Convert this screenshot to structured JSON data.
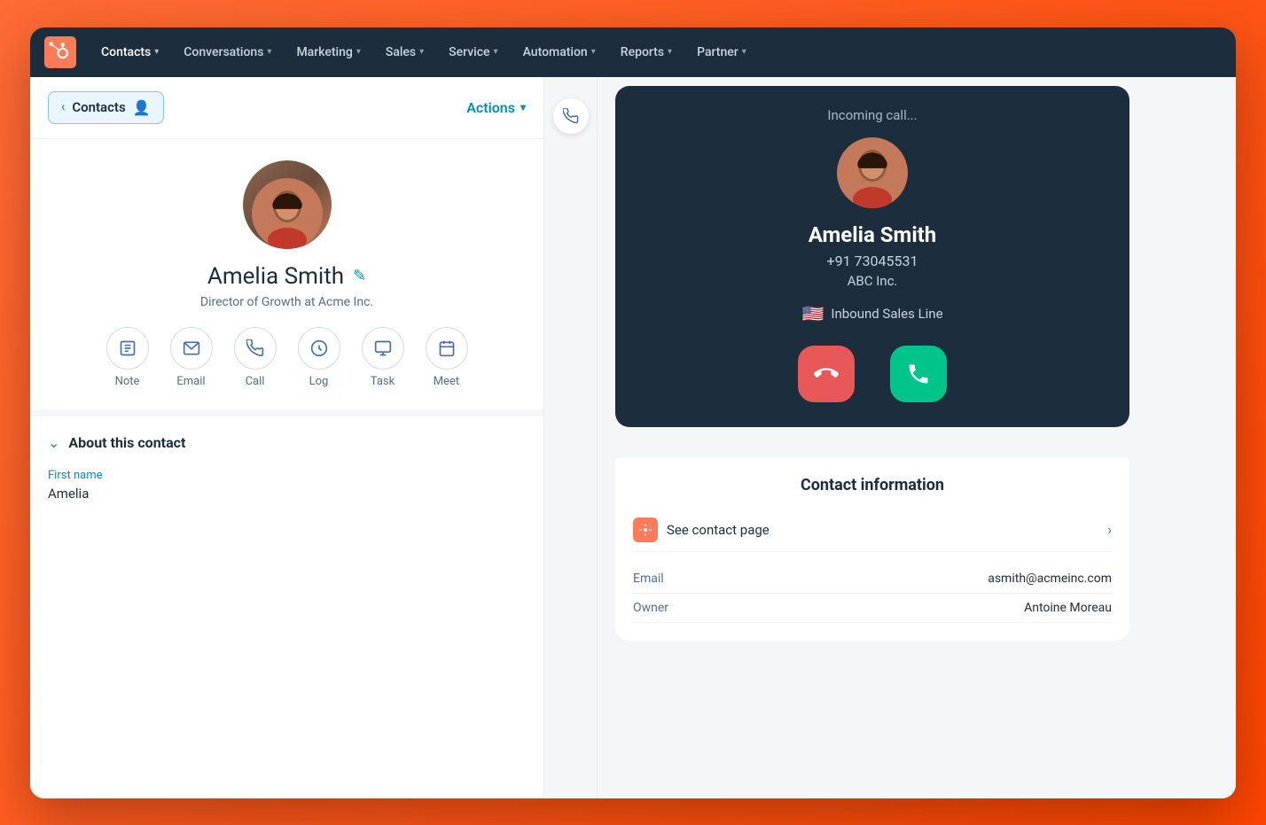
{
  "navbar": {
    "items": [
      {
        "label": "Contacts",
        "id": "contacts"
      },
      {
        "label": "Conversations",
        "id": "conversations"
      },
      {
        "label": "Marketing",
        "id": "marketing"
      },
      {
        "label": "Sales",
        "id": "sales"
      },
      {
        "label": "Service",
        "id": "service"
      },
      {
        "label": "Automation",
        "id": "automation"
      },
      {
        "label": "Reports",
        "id": "reports"
      },
      {
        "label": "Partner",
        "id": "partner"
      }
    ]
  },
  "panel": {
    "back_label": "Contacts",
    "actions_label": "Actions"
  },
  "contact": {
    "name": "Amelia Smith",
    "title": "Director of Growth at Acme Inc.",
    "actions": [
      {
        "icon": "✎",
        "label": "Note",
        "id": "note"
      },
      {
        "icon": "✉",
        "label": "Email",
        "id": "email"
      },
      {
        "icon": "✆",
        "label": "Call",
        "id": "call"
      },
      {
        "icon": "+",
        "label": "Log",
        "id": "log"
      },
      {
        "icon": "☰",
        "label": "Task",
        "id": "task"
      },
      {
        "icon": "▦",
        "label": "Meet",
        "id": "meet"
      }
    ],
    "about_title": "About this contact",
    "first_name_label": "First name",
    "first_name": "Amelia"
  },
  "incoming_call": {
    "label": "Incoming call...",
    "caller_name": "Amelia Smith",
    "caller_phone": "+91 73045531",
    "caller_company": "ABC Inc.",
    "sales_line": "Inbound Sales Line",
    "flag": "🇺🇸",
    "decline_icon": "📞",
    "accept_icon": "📞"
  },
  "contact_info": {
    "title": "Contact information",
    "see_contact_label": "See contact page",
    "email_label": "Email",
    "email_value": "asmith@acmeinc.com",
    "owner_label": "Owner",
    "owner_value": "Antoine Moreau"
  }
}
